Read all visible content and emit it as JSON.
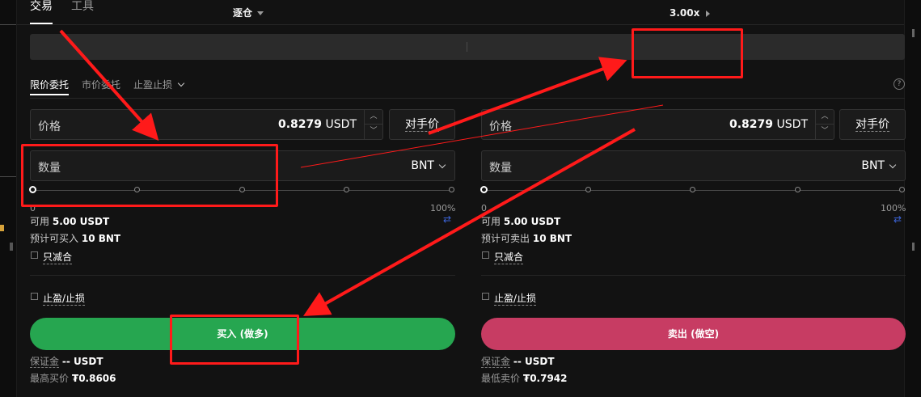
{
  "top_tabs": [
    "交易",
    "工具"
  ],
  "mode_bar": {
    "margin_mode": "逐仓",
    "leverage": "3.00x"
  },
  "order_tabs": [
    "限价委托",
    "市价委托",
    "止盈止损"
  ],
  "help_icon": "?",
  "buy": {
    "price_label": "价格",
    "price_value": "0.8279",
    "price_unit": "USDT",
    "counter_label": "对手价",
    "qty_label": "数量",
    "qty_unit": "BNT",
    "slider_min": "0",
    "slider_max": "100%",
    "slider_level": 0,
    "avail_label": "可用",
    "avail_value": "5.00 USDT",
    "est_label": "预计可买入",
    "est_value": "10 BNT",
    "reduce_label": "只减合",
    "tpsl_label": "止盈/止损",
    "button_label": "买入 (做多)",
    "margin_label": "保证金",
    "margin_value": "-- USDT",
    "limit_label": "最高买价",
    "limit_value": "₮0.8606"
  },
  "sell": {
    "price_label": "价格",
    "price_value": "0.8279",
    "price_unit": "USDT",
    "counter_label": "对手价",
    "qty_label": "数量",
    "qty_unit": "BNT",
    "slider_min": "0",
    "slider_max": "100%",
    "slider_level": 0,
    "avail_label": "可用",
    "avail_value": "5.00 USDT",
    "est_label": "预计可卖出",
    "est_value": "10 BNT",
    "reduce_label": "只减合",
    "tpsl_label": "止盈/止损",
    "button_label": "卖出 (做空)",
    "margin_label": "保证金",
    "margin_value": "-- USDT",
    "limit_label": "最低卖价",
    "limit_value": "₮0.7942"
  },
  "colors": {
    "buy": "#26a650",
    "sell": "#c73c63",
    "annotation": "#ff1a1a",
    "swap_icon": "#3b63d6"
  },
  "icons": {
    "margin_caret": "caret-down-icon",
    "leverage_caret": "caret-right-icon",
    "stepper": "stepper-arrows-icon",
    "swap": "swap-icon",
    "unit_dropdown": "chevron-down-icon"
  }
}
